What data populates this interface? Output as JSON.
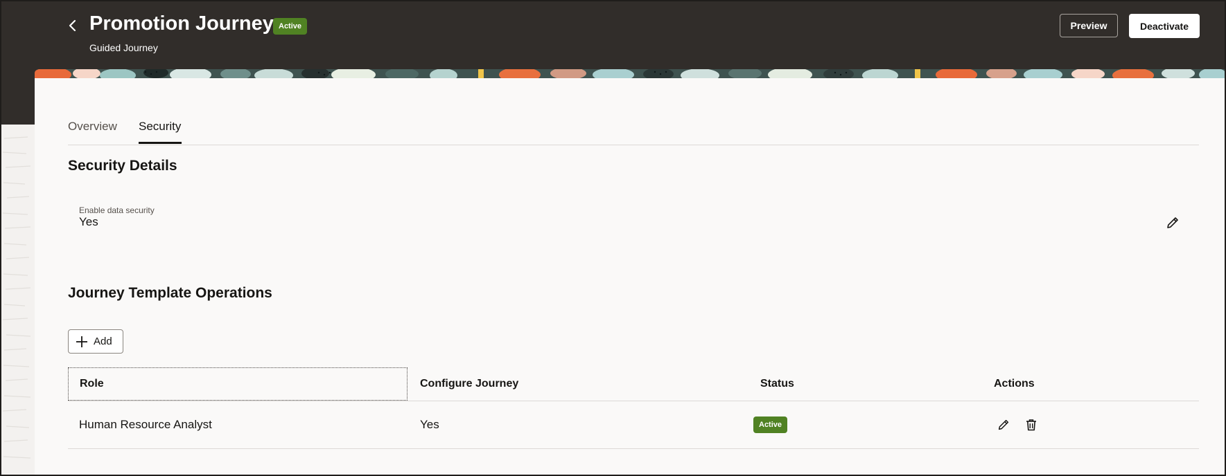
{
  "header": {
    "title": "Promotion Journey",
    "status_badge": "Active",
    "subtitle": "Guided Journey",
    "preview_label": "Preview",
    "deactivate_label": "Deactivate",
    "back_icon": "chevron-left-icon"
  },
  "tabs": [
    {
      "label": "Overview",
      "selected": false
    },
    {
      "label": "Security",
      "selected": true
    }
  ],
  "security_details": {
    "title": "Security Details",
    "field_label": "Enable data security",
    "field_value": "Yes",
    "edit_icon": "pencil-icon"
  },
  "operations": {
    "title": "Journey Template Operations",
    "add_label": "Add",
    "columns": [
      "Role",
      "Configure Journey",
      "Status",
      "Actions"
    ],
    "rows": [
      {
        "role": "Human Resource Analyst",
        "configure_journey": "Yes",
        "status": "Active"
      }
    ]
  },
  "colors": {
    "header_bg": "#312d2a",
    "status_green": "#508223",
    "card_bg": "#faf9f8"
  }
}
